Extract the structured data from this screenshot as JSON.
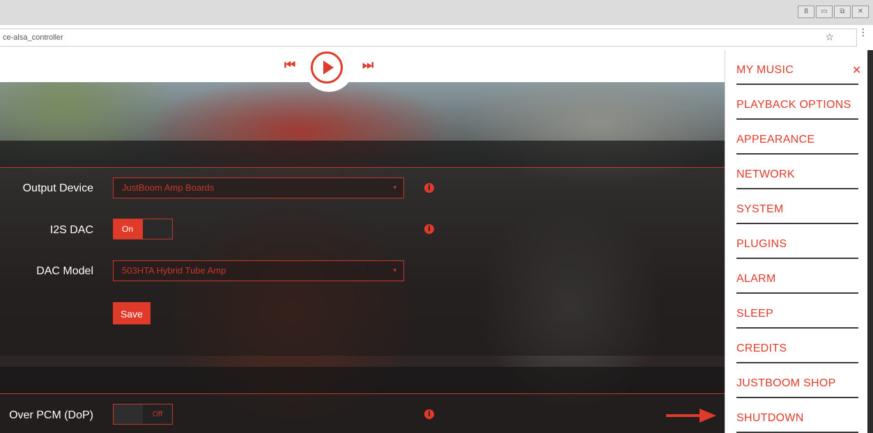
{
  "browser": {
    "window_controls": [
      "8",
      "▭",
      "⧉",
      "✕"
    ],
    "address_text": "ce-alsa_controller",
    "star_icon": "☆",
    "menu_icon": "⋮"
  },
  "transport": {
    "prev_icon": "skip-previous-icon",
    "play_icon": "play-icon",
    "next_icon": "skip-next-icon"
  },
  "output": {
    "output_device_label": "Output Device",
    "output_device_value": "JustBoom Amp Boards",
    "i2s_dac_label": "I2S DAC",
    "i2s_dac_state": "On",
    "dac_model_label": "DAC Model",
    "dac_model_value": "503HTA Hybrid Tube Amp",
    "save_label": "Save",
    "dop_label": "Over PCM (DoP)",
    "dop_state": "Off",
    "caret": "▾",
    "info_glyph": "i"
  },
  "menu": {
    "close_glyph": "✕",
    "items": [
      "MY MUSIC",
      "PLAYBACK OPTIONS",
      "APPEARANCE",
      "NETWORK",
      "SYSTEM",
      "PLUGINS",
      "ALARM",
      "SLEEP",
      "CREDITS",
      "JUSTBOOM SHOP",
      "SHUTDOWN"
    ]
  },
  "colors": {
    "accent": "#e03a2a",
    "menu_bg": "#ffffff",
    "menu_divider": "#3a3a3a"
  }
}
